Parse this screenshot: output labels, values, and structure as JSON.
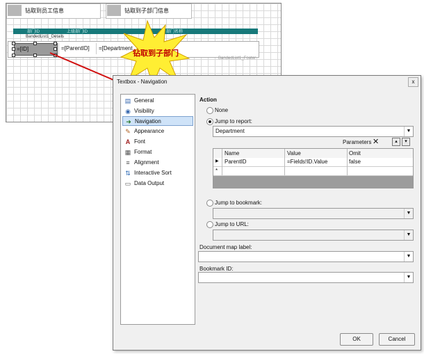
{
  "designer": {
    "textbox_employee": "钻取到员工信息",
    "textbox_department": "钻取到子部门信息",
    "header_col1": "部门ID",
    "header_col2": "上级部门ID",
    "header_col3": "部门名称",
    "banded_caption": "BandedList1_Details",
    "field_id": "=[ID]",
    "field_parent": "=[ParentID]",
    "field_department": "=[Department",
    "footer_caption": "BandedList1_Footer",
    "callout": "钻取到子部门"
  },
  "dialog": {
    "title": "Textbox - Navigation",
    "close": "x",
    "sidebar": [
      {
        "label": "General",
        "icon": "general-icon"
      },
      {
        "label": "Visibility",
        "icon": "visibility-icon"
      },
      {
        "label": "Navigation",
        "icon": "navigation-icon"
      },
      {
        "label": "Appearance",
        "icon": "appearance-icon"
      },
      {
        "label": "Font",
        "icon": "font-icon"
      },
      {
        "label": "Format",
        "icon": "format-icon"
      },
      {
        "label": "Alignment",
        "icon": "alignment-icon"
      },
      {
        "label": "Interactive Sort",
        "icon": "interactive-sort-icon"
      },
      {
        "label": "Data Output",
        "icon": "data-output-icon"
      }
    ],
    "action_title": "Action",
    "opt_none": "None",
    "opt_report": "Jump to report:",
    "report_value": "Department",
    "parameters_label": "Parameters",
    "param_headers": [
      "Name",
      "Value",
      "Omit"
    ],
    "param_row": {
      "name": "ParentID",
      "value": "=Fields!ID.Value",
      "omit": "false"
    },
    "new_row_marker": "*",
    "opt_bookmark": "Jump to bookmark:",
    "opt_url": "Jump to URL:",
    "doc_map_label": "Document map label:",
    "bookmark_id_label": "Bookmark ID:",
    "ok": "OK",
    "cancel": "Cancel"
  },
  "colors": {
    "teal": "#17797a",
    "burst_fill": "#ffee33",
    "burst_text": "#c00000",
    "arrow": "#d01010"
  }
}
